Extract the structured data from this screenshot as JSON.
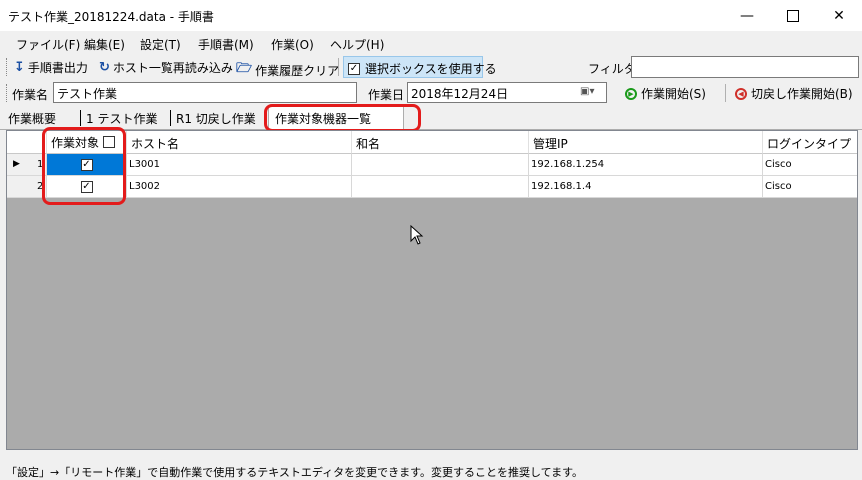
{
  "window": {
    "title": "テスト作業_20181224.data - 手順書",
    "minimize_icon": "minimize-icon",
    "maximize_icon": "maximize-icon",
    "close_icon": "close-icon"
  },
  "menu": [
    "ファイル(F)",
    "編集(E)",
    "設定(T)",
    "手順書(M)",
    "作業(O)",
    "ヘルプ(H)"
  ],
  "toolbar": {
    "export_label": "手順書出力",
    "reload_label": "ホスト一覧再読み込み",
    "clear_label": "作業履歴クリア",
    "use_selection_label": "選択ボックスを使用する",
    "use_selection_checked": true,
    "filter_label": "フィルタ:",
    "filter_value": ""
  },
  "work": {
    "name_label": "作業名",
    "name_value": "テスト作業",
    "date_label": "作業日",
    "date_value": "2018年12月24日",
    "start_label": "作業開始(S)",
    "rollback_label": "切戻し作業開始(B)"
  },
  "tabs": [
    "作業概要",
    "1 テスト作業",
    "R1 切戻し作業",
    "作業対象機器一覧"
  ],
  "active_tab_index": 3,
  "grid": {
    "columns": [
      "作業対象",
      "ホスト名",
      "和名",
      "管理IP",
      "ログインタイプ"
    ],
    "rows": [
      {
        "index": "1",
        "selected": true,
        "host": "L3001",
        "alias": "",
        "ip": "192.168.1.254",
        "login": "Cisco"
      },
      {
        "index": "2",
        "selected": true,
        "host": "L3002",
        "alias": "",
        "ip": "192.168.1.4",
        "login": "Cisco"
      }
    ]
  },
  "status": "「設定」→「リモート作業」で自動作業で使用するテキストエディタを変更できます。変更することを推奨してます。",
  "colors": {
    "highlight_red": "#e31b1b",
    "selection_blue": "#0078d7",
    "toggle_bg": "#cde5f7"
  }
}
